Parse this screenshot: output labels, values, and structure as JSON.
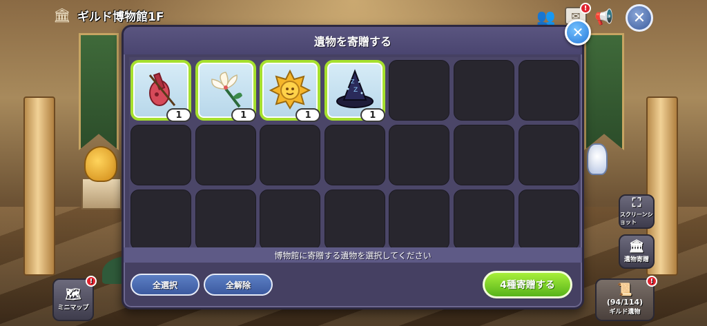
{
  "hud": {
    "title": "ギルド博物館1F",
    "mail_alert": "!",
    "close_label": "✕"
  },
  "modal": {
    "title": "遺物を寄贈する",
    "close_label": "✕",
    "hint": "博物館に寄贈する遺物を選択してください",
    "select_all": "全選択",
    "deselect_all": "全解除",
    "donate": "4種寄贈する"
  },
  "inventory": {
    "columns": 7,
    "rows": 3,
    "items": [
      {
        "icon": "violin-icon",
        "quantity": "1"
      },
      {
        "icon": "lily-flower-icon",
        "quantity": "1"
      },
      {
        "icon": "sun-medal-icon",
        "quantity": "1"
      },
      {
        "icon": "wizard-hat-icon",
        "quantity": "1"
      }
    ]
  },
  "side": {
    "screenshot": "スクリーンショット",
    "relic_donate": "遺物寄贈",
    "minimap": "ミニマップ",
    "guild_relic_count": "(94/114)",
    "guild_relic": "ギルド遺物",
    "alert": "!"
  },
  "colors": {
    "modal_bg": "#454062",
    "slot_empty": "#28262e",
    "slot_selected_border": "#a6e02e",
    "donate_button": "#57b31a",
    "secondary_button": "#3c5aa0",
    "close_button": "#2778d8",
    "alert": "#e0232f"
  }
}
